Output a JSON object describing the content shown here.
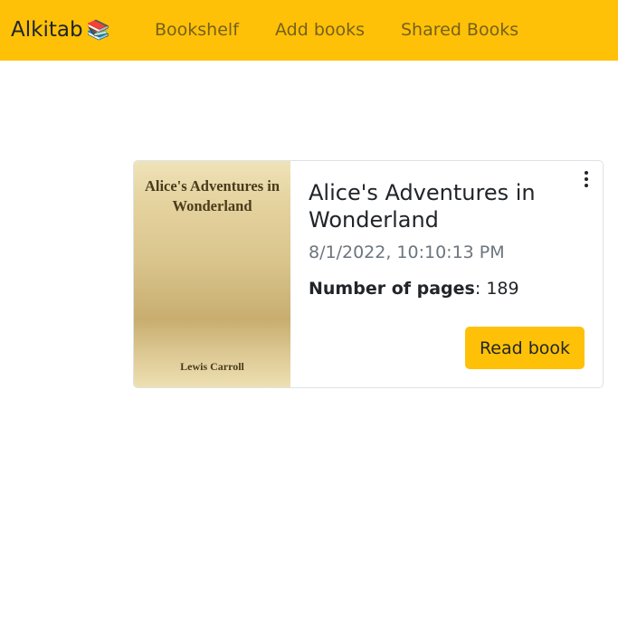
{
  "navbar": {
    "brand": "Alkitab",
    "brand_emoji": "📚",
    "links": [
      {
        "label": "Bookshelf"
      },
      {
        "label": "Add books"
      },
      {
        "label": "Shared Books"
      }
    ]
  },
  "book": {
    "cover_title": "Alice's Adventures in Wonderland",
    "cover_author": "Lewis Carroll",
    "title": "Alice's Adventures in Wonderland",
    "date": "8/1/2022, 10:10:13 PM",
    "pages_label": "Number of pages",
    "pages_separator": ":",
    "pages_value": "189",
    "menu_icon": "kebab-menu-icon",
    "read_button": "Read book"
  },
  "colors": {
    "accent": "#ffc107",
    "muted_text": "#6c757d",
    "text": "#212529"
  }
}
